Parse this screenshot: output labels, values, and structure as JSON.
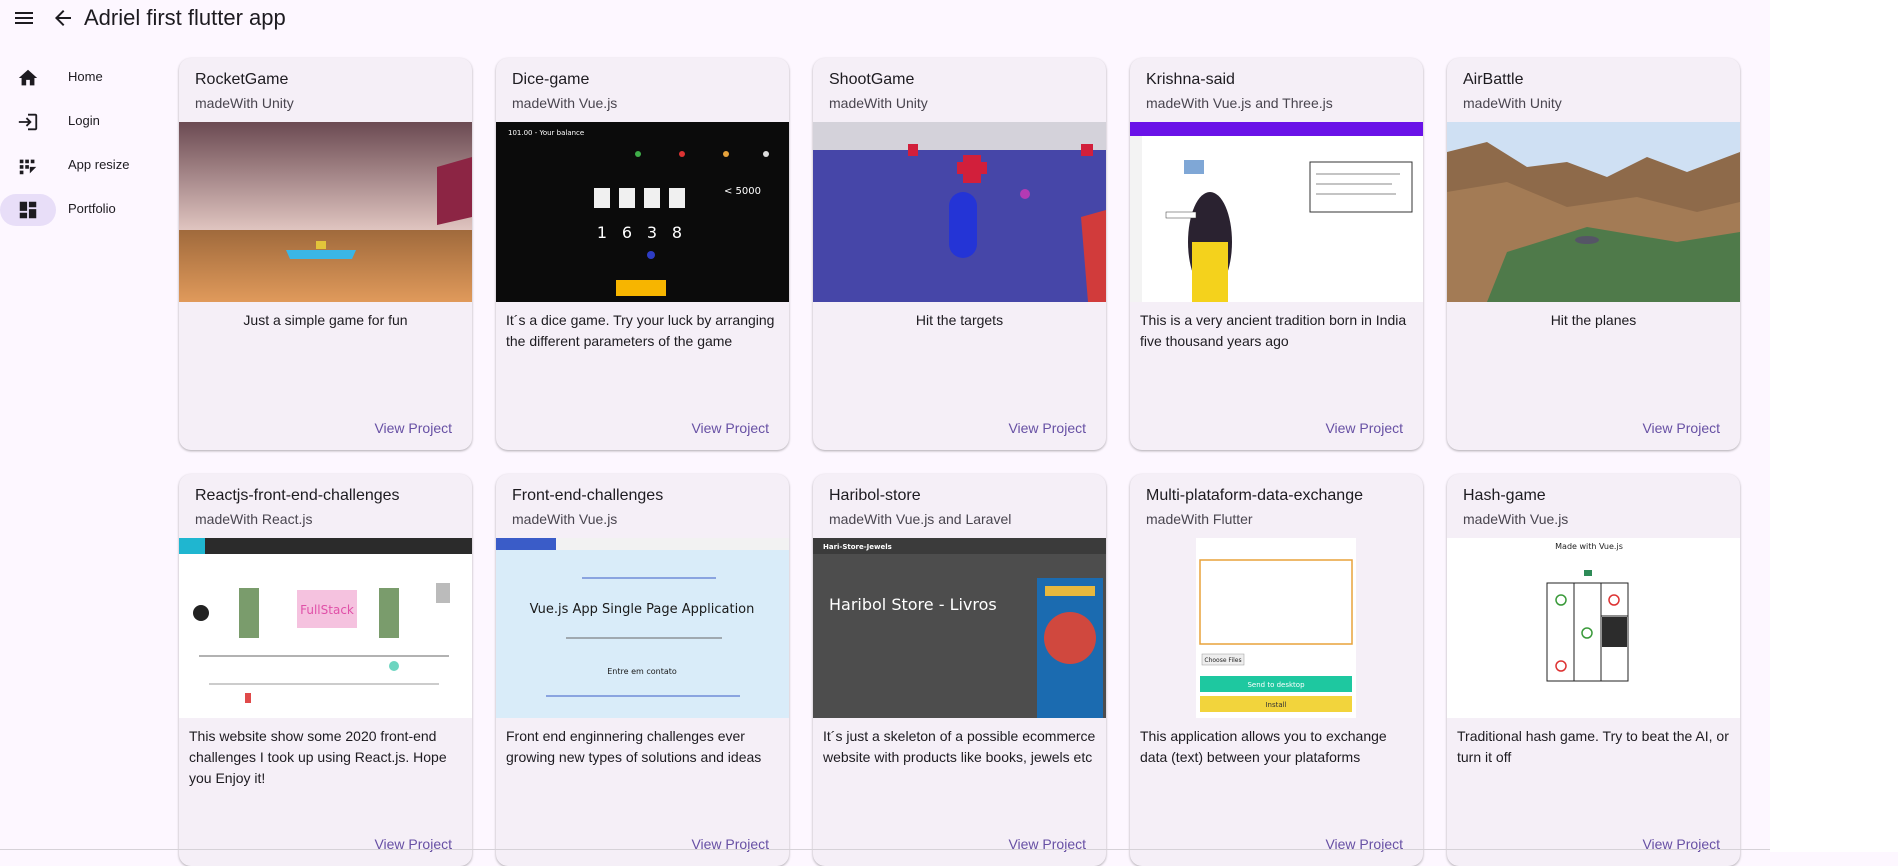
{
  "appbar": {
    "title": "Adriel first flutter app"
  },
  "nav": {
    "items": [
      {
        "label": "Home"
      },
      {
        "label": "Login"
      },
      {
        "label": "App resize"
      },
      {
        "label": "Portfolio"
      }
    ]
  },
  "cards": [
    {
      "title": "RocketGame",
      "subtitle": "madeWith Unity",
      "description": "Just a simple game for fun",
      "link": "View Project"
    },
    {
      "title": "Dice-game",
      "subtitle": "madeWith Vue.js",
      "description": "It´s a dice game. Try your luck by arranging the different parameters of the game",
      "link": "View Project",
      "screenshot": {
        "balance": "101.00 - Your balance",
        "target": "< 5000",
        "dice": [
          "1",
          "6",
          "3",
          "8"
        ]
      }
    },
    {
      "title": "ShootGame",
      "subtitle": "madeWith Unity",
      "description": "Hit the targets",
      "link": "View Project"
    },
    {
      "title": "Krishna-said",
      "subtitle": "madeWith Vue.js and Three.js",
      "description": "This is a very ancient tradition born in India five thousand years ago",
      "link": "View Project"
    },
    {
      "title": "AirBattle",
      "subtitle": "madeWith Unity",
      "description": "Hit the planes",
      "link": "View Project"
    },
    {
      "title": "Reactjs-front-end-challenges",
      "subtitle": "madeWith React.js",
      "description": "This website show some 2020 front-end challenges I took up using React.js. Hope you Enjoy it!",
      "link": "View Project",
      "screenshot": {
        "banner": "FullStack"
      }
    },
    {
      "title": "Front-end-challenges",
      "subtitle": "madeWith Vue.js",
      "description": "Front end enginnering challenges ever growing new types of solutions and ideas",
      "link": "View Project",
      "screenshot": {
        "heading": "Vue.js App Single Page Application",
        "contact": "Entre em contato"
      }
    },
    {
      "title": "Haribol-store",
      "subtitle": "madeWith Vue.js and Laravel",
      "description": "It´s just a skeleton of a possible ecommerce website with products like books, jewels etc",
      "link": "View Project",
      "screenshot": {
        "brand": "Hari-Store-Jewels",
        "heading": "Haribol Store - Livros"
      }
    },
    {
      "title": "Multi-plataform-data-exchange",
      "subtitle": "madeWith Flutter",
      "description": "This application allows you to exchange data (text) between your plataforms",
      "link": "View Project",
      "screenshot": {
        "file_button": "Choose Files",
        "send_button": "Send to desktop",
        "install_button": "Install"
      }
    },
    {
      "title": "Hash-game",
      "subtitle": "madeWith Vue.js",
      "description": "Traditional hash game. Try to beat the AI, or turn it off",
      "link": "View Project",
      "screenshot": {
        "heading": "Made with Vue.js"
      }
    }
  ],
  "colors": {
    "accent": "#6750a4",
    "surface": "#fdf7ff",
    "card": "#f5eff7",
    "nav_indicator": "#e8def8"
  }
}
